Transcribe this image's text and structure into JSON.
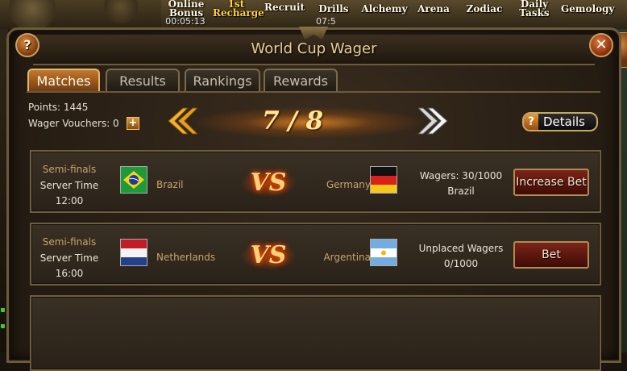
{
  "hud": {
    "online_bonus_line1": "Online",
    "online_bonus_line2": "Bonus",
    "timer": "00:05:13",
    "first_recharge_line1": "1st",
    "first_recharge_line2": "Recharge",
    "recruit": "Recruit",
    "drills": "Drills",
    "alchemy": "Alchemy",
    "arena": "Arena",
    "zodiac": "Zodiac",
    "daily_tasks_line1": "Daily",
    "daily_tasks_line2": "Tasks",
    "gemology": "Gemology",
    "partial_time": "07:5"
  },
  "dialog": {
    "title": "World Cup Wager",
    "help_symbol": "?",
    "close_symbol": "✕"
  },
  "tabs": [
    {
      "label": "Matches",
      "active": true
    },
    {
      "label": "Results",
      "active": false
    },
    {
      "label": "Rankings",
      "active": false
    },
    {
      "label": "Rewards",
      "active": false
    }
  ],
  "info": {
    "points": "Points: 1445",
    "vouchers": "Wager Vouchers: 0",
    "plus_symbol": "+"
  },
  "pager": {
    "current": "7 / 8"
  },
  "details": {
    "icon": "?",
    "label": "Details"
  },
  "matches": [
    {
      "round": "Semi-finals",
      "time_label": "Server Time",
      "time": "12:00",
      "team_a": "Brazil",
      "team_b": "Germany",
      "vs": "VS",
      "wager_line1": "Wagers: 30/1000",
      "wager_line2": "Brazil",
      "button": "Increase Bet"
    },
    {
      "round": "Semi-finals",
      "time_label": "Server Time",
      "time": "16:00",
      "team_a": "Netherlands",
      "team_b": "Argentina",
      "vs": "VS",
      "wager_line1": "Unplaced Wagers",
      "wager_line2": "0/1000",
      "button": "Bet"
    }
  ],
  "colors": {
    "panel_border": "#6b5a3c",
    "active_tab": "#c3782e",
    "gold_text": "#c8a46a",
    "button_red": "#7c2418"
  },
  "icons": [
    "help-icon",
    "close-icon",
    "plus-icon",
    "arrow-left-icon",
    "arrow-right-icon",
    "brazil-flag-icon",
    "germany-flag-icon",
    "netherlands-flag-icon",
    "argentina-flag-icon"
  ]
}
